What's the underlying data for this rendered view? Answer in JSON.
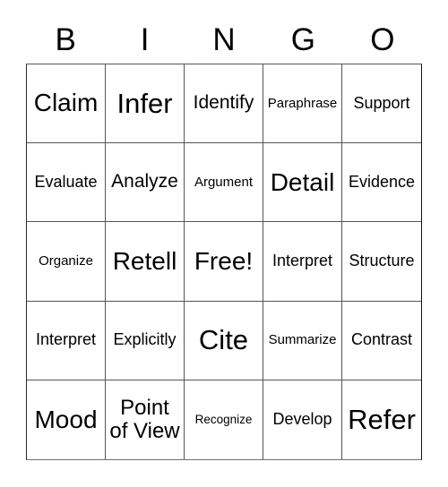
{
  "card": {
    "title": "BINGO",
    "header_letters": [
      "B",
      "I",
      "N",
      "G",
      "O"
    ],
    "free_space_label": "Free!",
    "grid_size": "5x5",
    "colors": {
      "text": "#000000",
      "background": "#ffffff",
      "border": "#555555"
    },
    "rows": [
      [
        {
          "label": "Claim",
          "size": "xl"
        },
        {
          "label": "Infer",
          "size": "xxl"
        },
        {
          "label": "Identify",
          "size": "md"
        },
        {
          "label": "Paraphrase",
          "size": "xs"
        },
        {
          "label": "Support",
          "size": "sm"
        }
      ],
      [
        {
          "label": "Evaluate",
          "size": "sm"
        },
        {
          "label": "Analyze",
          "size": "md"
        },
        {
          "label": "Argument",
          "size": "xs"
        },
        {
          "label": "Detail",
          "size": "xl"
        },
        {
          "label": "Evidence",
          "size": "sm"
        }
      ],
      [
        {
          "label": "Organize",
          "size": "xs"
        },
        {
          "label": "Retell",
          "size": "xl"
        },
        {
          "label": "Free!",
          "size": "xl"
        },
        {
          "label": "Interpret",
          "size": "sm"
        },
        {
          "label": "Structure",
          "size": "sm"
        }
      ],
      [
        {
          "label": "Interpret",
          "size": "sm"
        },
        {
          "label": "Explicitly",
          "size": "sm"
        },
        {
          "label": "Cite",
          "size": "xxl"
        },
        {
          "label": "Summarize",
          "size": "xs"
        },
        {
          "label": "Contrast",
          "size": "sm"
        }
      ],
      [
        {
          "label": "Mood",
          "size": "xl"
        },
        {
          "label": "Point\nof View",
          "size": "lg"
        },
        {
          "label": "Recognize",
          "size": "xxs"
        },
        {
          "label": "Develop",
          "size": "sm"
        },
        {
          "label": "Refer",
          "size": "xxl"
        }
      ]
    ]
  }
}
